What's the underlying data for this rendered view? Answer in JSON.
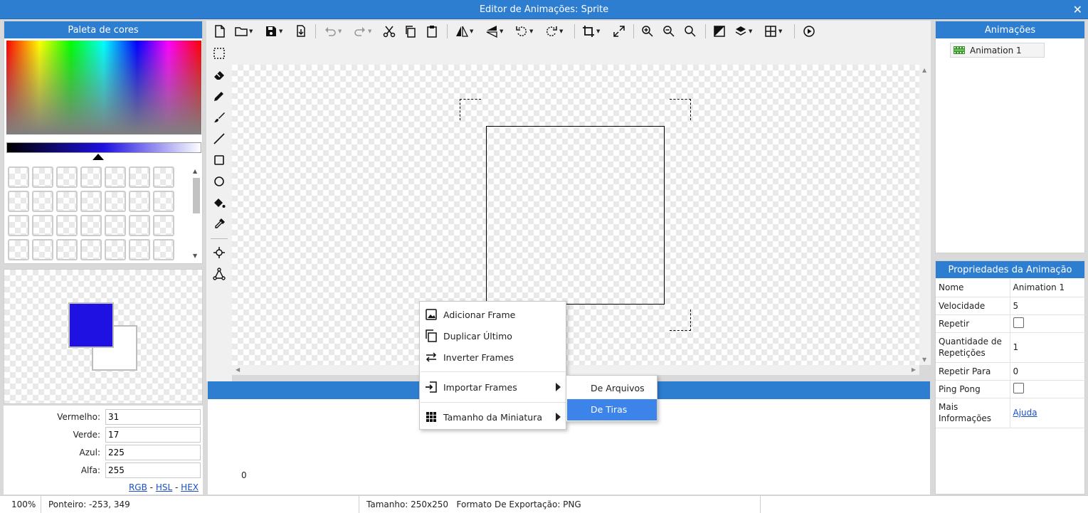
{
  "window": {
    "title": "Editor de Animações: Sprite",
    "close_label": "✕"
  },
  "palette": {
    "header": "Paleta de cores"
  },
  "colors": {
    "foreground": "#1f11e1",
    "background": "#ffffff",
    "accent": "#2d7ed0",
    "highlight": "#3d84ea"
  },
  "rgba": {
    "red_label": "Vermelho:",
    "red_value": "31",
    "green_label": "Verde:",
    "green_value": "17",
    "blue_label": "Azul:",
    "blue_value": "225",
    "alpha_label": "Alfa:",
    "alpha_value": "255",
    "modes": [
      "RGB",
      "HSL",
      "HEX"
    ],
    "sep": "-"
  },
  "toolbar": {
    "icons": [
      "new-file-icon",
      "open-folder-icon",
      "save-icon",
      "export-icon",
      "undo-icon",
      "redo-icon",
      "cut-icon",
      "copy-icon",
      "paste-icon",
      "flip-horizontal-icon",
      "flip-vertical-icon",
      "rotate-left-icon",
      "rotate-right-icon",
      "crop-icon",
      "fullscreen-icon",
      "zoom-in-icon",
      "zoom-out-icon",
      "zoom-reset-icon",
      "color-mode-icon",
      "layers-icon",
      "grid-icon",
      "play-icon"
    ]
  },
  "tools": [
    "select-icon",
    "eraser-icon",
    "pencil-icon",
    "brush-icon",
    "line-icon",
    "rectangle-icon",
    "ellipse-icon",
    "fill-bucket-icon",
    "eyedropper-icon",
    "pivot-icon",
    "bone-icon"
  ],
  "timeline": {
    "frame_number": "0"
  },
  "context_menu": {
    "items": [
      {
        "label": "Adicionar Frame",
        "icon": "image-icon"
      },
      {
        "label": "Duplicar Último",
        "icon": "duplicate-icon"
      },
      {
        "label": "Inverter Frames",
        "icon": "swap-icon"
      },
      {
        "label": "Importar Frames",
        "icon": "import-icon"
      },
      {
        "label": "Tamanho da Miniatura",
        "icon": "grid-dots-icon"
      }
    ],
    "submenu": [
      "De Arquivos",
      "De Tiras"
    ]
  },
  "animations": {
    "header": "Animações",
    "items": [
      "Animation 1"
    ]
  },
  "properties": {
    "header": "Propriedades da Animação",
    "name_label": "Nome",
    "name_value": "Animation 1",
    "speed_label": "Velocidade",
    "speed_value": "5",
    "repeat_label": "Repetir",
    "repeat_count_label": "Quantidade de Repetições",
    "repeat_count_value": "1",
    "repeat_to_label": "Repetir Para",
    "repeat_to_value": "0",
    "pingpong_label": "Ping Pong",
    "more_info_label": "Mais Informações",
    "more_info_link": "Ajuda"
  },
  "status": {
    "zoom": "100%",
    "pointer": "Ponteiro: -253, 349",
    "size": "Tamanho: 250x250",
    "export_format": "Formato De Exportação: PNG"
  }
}
